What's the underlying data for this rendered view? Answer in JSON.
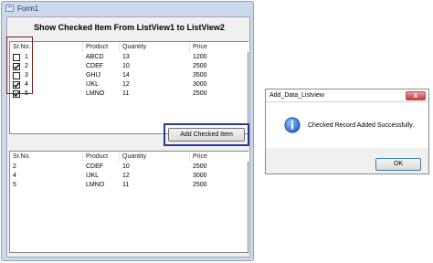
{
  "form": {
    "title": "Form1",
    "heading": "Show Checked Item From ListView1 to ListView2",
    "button_label": "Add Checked Item"
  },
  "listview1": {
    "columns": [
      "Sr.No.",
      "Product",
      "Quantity",
      "Price"
    ],
    "rows": [
      {
        "sr": "1",
        "product": "ABCD",
        "quantity": "13",
        "price": "1200",
        "checked": false
      },
      {
        "sr": "2",
        "product": "CDEF",
        "quantity": "10",
        "price": "2500",
        "checked": true
      },
      {
        "sr": "3",
        "product": "GHIJ",
        "quantity": "14",
        "price": "3500",
        "checked": false
      },
      {
        "sr": "4",
        "product": "IJKL",
        "quantity": "12",
        "price": "3000",
        "checked": true
      },
      {
        "sr": "5",
        "product": "LMNO",
        "quantity": "11",
        "price": "2500",
        "checked": true
      }
    ]
  },
  "listview2": {
    "columns": [
      "Sr.No.",
      "Product",
      "Quantity",
      "Price"
    ],
    "rows": [
      {
        "sr": "2",
        "product": "CDEF",
        "quantity": "10",
        "price": "2500"
      },
      {
        "sr": "4",
        "product": "IJKL",
        "quantity": "12",
        "price": "3000"
      },
      {
        "sr": "5",
        "product": "LMNO",
        "quantity": "11",
        "price": "2500"
      }
    ]
  },
  "dialog": {
    "title": "Add_Data_Listview",
    "message": "Checked Record Added Successfully.",
    "ok_label": "OK",
    "close_symbol": "x"
  },
  "colors": {
    "window_border": "#8da2bf",
    "annotation_red": "#7a1e1e",
    "annotation_blue": "#2b3a8f",
    "info_blue": "#2a6fc9"
  },
  "icons": [
    "form-icon",
    "check-icon",
    "info-icon",
    "close-icon"
  ]
}
